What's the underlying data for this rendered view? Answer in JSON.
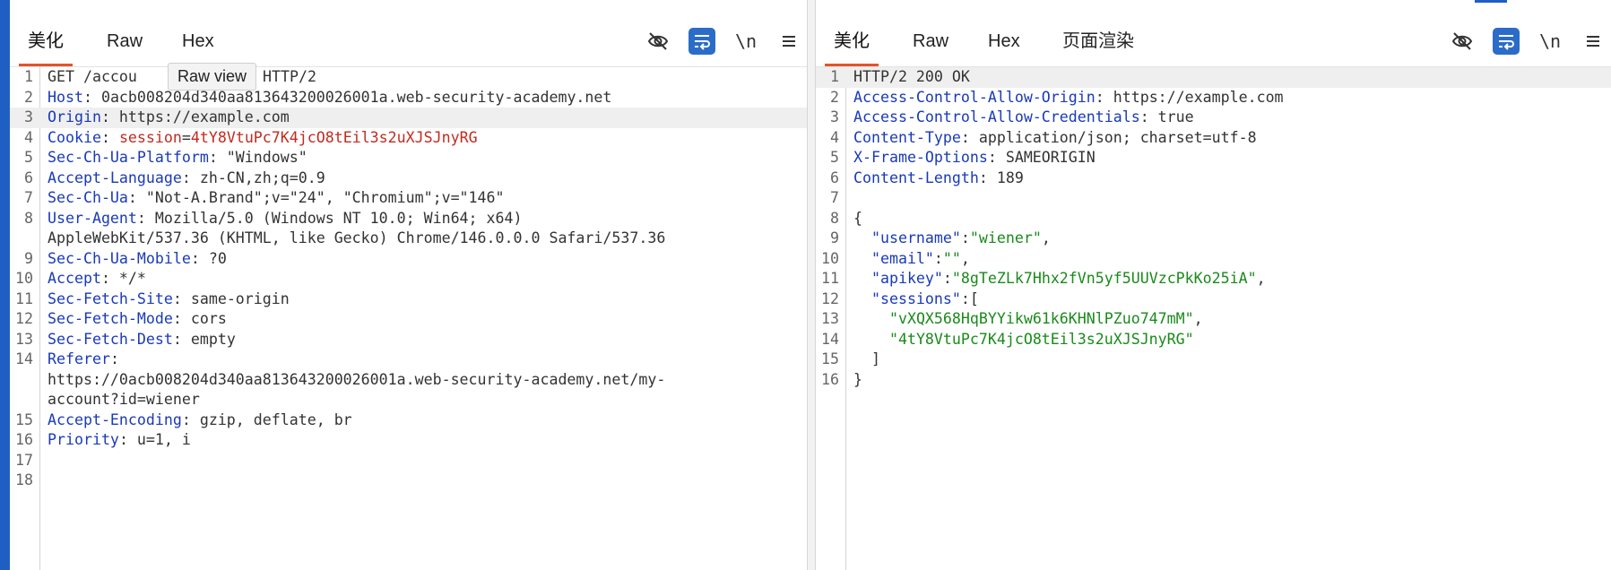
{
  "request": {
    "tabs": [
      "美化",
      "Raw",
      "Hex"
    ],
    "active_tab": "美化",
    "tooltip": "Raw view",
    "tools": {
      "hide_icon": "eye-off-icon",
      "wrap_icon": "wrap-lines-icon",
      "newline_label": "\\n",
      "menu_icon": "hamburger-icon"
    },
    "lines": [
      {
        "n": "1",
        "parts": [
          {
            "t": "GET /accou",
            "c": "plain"
          }
        ]
      },
      {
        "n": "2",
        "parts": [
          {
            "t": "Host",
            "c": "key"
          },
          {
            "t": ": 0acb008204d340aa813643200026001a.web-security-academy.net",
            "c": "plain"
          }
        ]
      },
      {
        "n": "3",
        "parts": [
          {
            "t": "Origin",
            "c": "key"
          },
          {
            "t": ": https://example.com",
            "c": "plain"
          }
        ]
      },
      {
        "n": "4",
        "parts": [
          {
            "t": "Cookie",
            "c": "key"
          },
          {
            "t": ": ",
            "c": "plain"
          },
          {
            "t": "session",
            "c": "cookie-key"
          },
          {
            "t": "=",
            "c": "plain"
          },
          {
            "t": "4tY8VtuPc7K4jcO8tEil3s2uXJSJnyRG",
            "c": "cookie-val"
          }
        ]
      },
      {
        "n": "5",
        "parts": [
          {
            "t": "Sec-Ch-Ua-Platform",
            "c": "key"
          },
          {
            "t": ": \"Windows\"",
            "c": "plain"
          }
        ]
      },
      {
        "n": "6",
        "parts": [
          {
            "t": "Accept-Language",
            "c": "key"
          },
          {
            "t": ": zh-CN,zh;q=0.9",
            "c": "plain"
          }
        ]
      },
      {
        "n": "7",
        "parts": [
          {
            "t": "Sec-Ch-Ua",
            "c": "key"
          },
          {
            "t": ": \"Not-A.Brand\";v=\"24\", \"Chromium\";v=\"146\"",
            "c": "plain"
          }
        ]
      },
      {
        "n": "8",
        "parts": [
          {
            "t": "User-Agent",
            "c": "key"
          },
          {
            "t": ": Mozilla/5.0 (Windows NT 10.0; Win64; x64)",
            "c": "plain"
          }
        ]
      },
      {
        "n": "",
        "parts": [
          {
            "t": "AppleWebKit/537.36 (KHTML, like Gecko) Chrome/146.0.0.0 Safari/537.36",
            "c": "plain"
          }
        ]
      },
      {
        "n": "9",
        "parts": [
          {
            "t": "Sec-Ch-Ua-Mobile",
            "c": "key"
          },
          {
            "t": ": ?0",
            "c": "plain"
          }
        ]
      },
      {
        "n": "10",
        "parts": [
          {
            "t": "Accept",
            "c": "key"
          },
          {
            "t": ": */*",
            "c": "plain"
          }
        ]
      },
      {
        "n": "11",
        "parts": [
          {
            "t": "Sec-Fetch-Site",
            "c": "key"
          },
          {
            "t": ": same-origin",
            "c": "plain"
          }
        ]
      },
      {
        "n": "12",
        "parts": [
          {
            "t": "Sec-Fetch-Mode",
            "c": "key"
          },
          {
            "t": ": cors",
            "c": "plain"
          }
        ]
      },
      {
        "n": "13",
        "parts": [
          {
            "t": "Sec-Fetch-Dest",
            "c": "key"
          },
          {
            "t": ": empty",
            "c": "plain"
          }
        ]
      },
      {
        "n": "14",
        "parts": [
          {
            "t": "Referer",
            "c": "key"
          },
          {
            "t": ":",
            "c": "plain"
          }
        ]
      },
      {
        "n": "",
        "parts": [
          {
            "t": "https://0acb008204d340aa813643200026001a.web-security-academy.net/my-",
            "c": "plain"
          }
        ]
      },
      {
        "n": "",
        "parts": [
          {
            "t": "account?id=wiener",
            "c": "plain"
          }
        ]
      },
      {
        "n": "15",
        "parts": [
          {
            "t": "Accept-Encoding",
            "c": "key"
          },
          {
            "t": ": gzip, deflate, br",
            "c": "plain"
          }
        ]
      },
      {
        "n": "16",
        "parts": [
          {
            "t": "Priority",
            "c": "key"
          },
          {
            "t": ": u=1, i",
            "c": "plain"
          }
        ]
      },
      {
        "n": "17",
        "parts": []
      },
      {
        "n": "18",
        "parts": []
      }
    ],
    "line1_tail": "HTTP/2"
  },
  "response": {
    "tabs": [
      "美化",
      "Raw",
      "Hex",
      "页面渲染"
    ],
    "active_tab": "美化",
    "tools": {
      "hide_icon": "eye-off-icon",
      "wrap_icon": "wrap-lines-icon",
      "newline_label": "\\n",
      "menu_icon": "hamburger-icon"
    },
    "lines": [
      {
        "n": "1",
        "parts": [
          {
            "t": "HTTP/2 200 OK",
            "c": "plain"
          }
        ]
      },
      {
        "n": "2",
        "parts": [
          {
            "t": "Access-Control-Allow-Origin",
            "c": "key"
          },
          {
            "t": ": https://example.com",
            "c": "plain"
          }
        ]
      },
      {
        "n": "3",
        "parts": [
          {
            "t": "Access-Control-Allow-Credentials",
            "c": "key"
          },
          {
            "t": ": true",
            "c": "plain"
          }
        ]
      },
      {
        "n": "4",
        "parts": [
          {
            "t": "Content-Type",
            "c": "key"
          },
          {
            "t": ": application/json; charset=utf-8",
            "c": "plain"
          }
        ]
      },
      {
        "n": "5",
        "parts": [
          {
            "t": "X-Frame-Options",
            "c": "key"
          },
          {
            "t": ": SAMEORIGIN",
            "c": "plain"
          }
        ]
      },
      {
        "n": "6",
        "parts": [
          {
            "t": "Content-Length",
            "c": "key"
          },
          {
            "t": ": 189",
            "c": "plain"
          }
        ]
      },
      {
        "n": "7",
        "parts": []
      },
      {
        "n": "8",
        "parts": [
          {
            "t": "{",
            "c": "plain"
          }
        ]
      },
      {
        "n": "9",
        "parts": [
          {
            "t": "  ",
            "c": "plain"
          },
          {
            "t": "\"username\"",
            "c": "json-key"
          },
          {
            "t": ":",
            "c": "plain"
          },
          {
            "t": "\"wiener\"",
            "c": "json-str"
          },
          {
            "t": ",",
            "c": "plain"
          }
        ]
      },
      {
        "n": "10",
        "parts": [
          {
            "t": "  ",
            "c": "plain"
          },
          {
            "t": "\"email\"",
            "c": "json-key"
          },
          {
            "t": ":",
            "c": "plain"
          },
          {
            "t": "\"\"",
            "c": "json-str"
          },
          {
            "t": ",",
            "c": "plain"
          }
        ]
      },
      {
        "n": "11",
        "parts": [
          {
            "t": "  ",
            "c": "plain"
          },
          {
            "t": "\"apikey\"",
            "c": "json-key"
          },
          {
            "t": ":",
            "c": "plain"
          },
          {
            "t": "\"8gTeZLk7Hhx2fVn5yf5UUVzcPkKo25iA\"",
            "c": "json-str"
          },
          {
            "t": ",",
            "c": "plain"
          }
        ]
      },
      {
        "n": "12",
        "parts": [
          {
            "t": "  ",
            "c": "plain"
          },
          {
            "t": "\"sessions\"",
            "c": "json-key"
          },
          {
            "t": ":[",
            "c": "plain"
          }
        ]
      },
      {
        "n": "13",
        "parts": [
          {
            "t": "    ",
            "c": "plain"
          },
          {
            "t": "\"vXQX568HqBYYikw61k6KHNlPZuo747mM\"",
            "c": "json-str"
          },
          {
            "t": ",",
            "c": "plain"
          }
        ]
      },
      {
        "n": "14",
        "parts": [
          {
            "t": "    ",
            "c": "plain"
          },
          {
            "t": "\"4tY8VtuPc7K4jcO8tEil3s2uXJSJnyRG\"",
            "c": "json-str"
          }
        ]
      },
      {
        "n": "15",
        "parts": [
          {
            "t": "  ]",
            "c": "plain"
          }
        ]
      },
      {
        "n": "16",
        "parts": [
          {
            "t": "}",
            "c": "plain"
          }
        ]
      }
    ]
  }
}
